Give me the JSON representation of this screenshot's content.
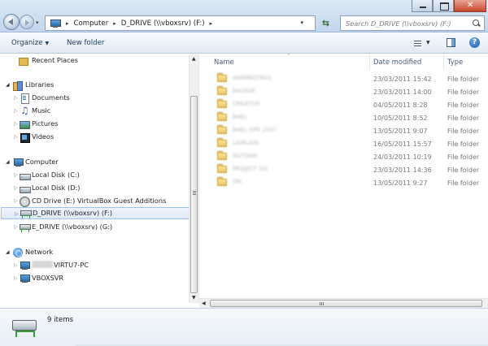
{
  "address_bar": {
    "crumbs": [
      "Computer",
      "D_DRIVE (\\\\vboxsrv) (F:)"
    ],
    "search_placeholder": "Search D_DRIVE (\\\\vboxsrv) (F:)"
  },
  "command_bar": {
    "organize_label": "Organize",
    "new_folder_label": "New folder"
  },
  "navigation": {
    "recent_places": "Recent Places",
    "libraries": {
      "label": "Libraries",
      "items": [
        "Documents",
        "Music",
        "Pictures",
        "Videos"
      ]
    },
    "computer": {
      "label": "Computer",
      "items": [
        "Local Disk (C:)",
        "Local Disk (D:)",
        "CD Drive (E:) VirtualBox Guest Additions",
        "D_DRIVE (\\\\vboxsrv) (F:)",
        "E_DRIVE (\\\\vboxsrv) (G:)"
      ],
      "selected_index": 3
    },
    "network": {
      "label": "Network",
      "items": [
        "VIRTU7-PC",
        "VBOXSVR"
      ]
    }
  },
  "file_list": {
    "columns": {
      "name": "Name",
      "date": "Date modified",
      "type": "Type"
    },
    "rows": [
      {
        "name": "ADMINISTRAS",
        "date": "23/03/2011 15:42",
        "type": "File folder"
      },
      {
        "name": "BACKUP",
        "date": "23/03/2011 14:00",
        "type": "File folder"
      },
      {
        "name": "CREATIVE",
        "date": "04/05/2011 8:28",
        "type": "File folder"
      },
      {
        "name": "BHEL",
        "date": "10/05/2011 8:52",
        "type": "File folder"
      },
      {
        "name": "BHEL OPE 2007",
        "date": "13/05/2011 9:07",
        "type": "File folder"
      },
      {
        "name": "LAINLAIN",
        "date": "16/05/2011 15:57",
        "type": "File folder"
      },
      {
        "name": "OUTSIDE",
        "date": "24/03/2011 10:19",
        "type": "File folder"
      },
      {
        "name": "PROJECT SIS",
        "date": "23/03/2011 14:36",
        "type": "File folder"
      },
      {
        "name": "TRI",
        "date": "13/05/2011 9:27",
        "type": "File folder"
      }
    ]
  },
  "details_pane": {
    "item_count": "9 items"
  },
  "icons": {
    "back": "back-arrow-icon",
    "forward": "forward-arrow-icon",
    "refresh": "refresh-icon",
    "search": "search-icon",
    "help": "help-icon"
  }
}
